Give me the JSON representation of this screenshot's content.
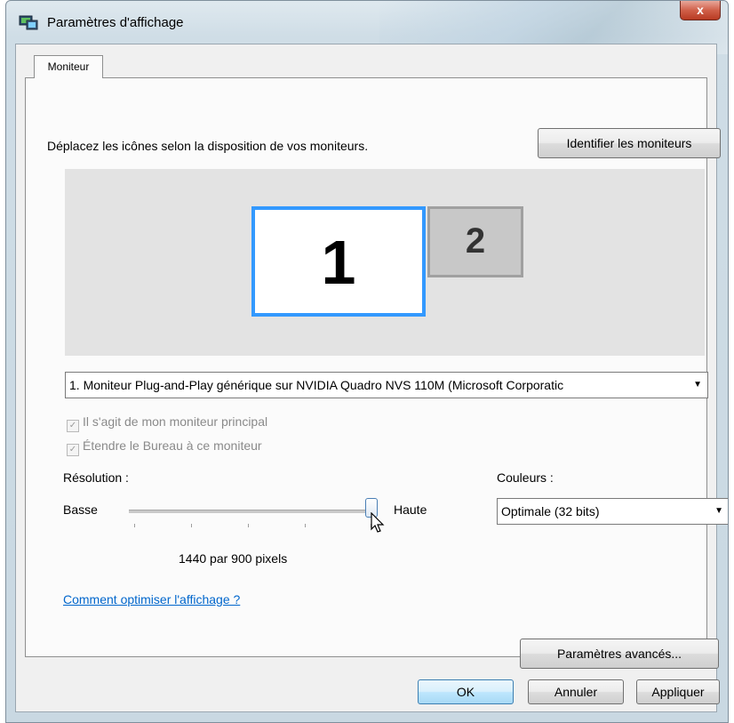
{
  "window": {
    "title": "Paramètres d'affichage",
    "close_label": "x"
  },
  "tabs": [
    {
      "label": "Moniteur",
      "selected": true
    }
  ],
  "main": {
    "instruction": "Déplacez les icônes selon la disposition de vos moniteurs.",
    "identify_button": "Identifier les moniteurs",
    "monitors": [
      {
        "number": "1",
        "selected": true
      },
      {
        "number": "2",
        "selected": false
      }
    ],
    "monitor_select": {
      "value": "1. Moniteur Plug-and-Play générique sur NVIDIA Quadro NVS 110M (Microsoft Corporatic",
      "arrow": "▼"
    },
    "checkboxes": [
      {
        "label": "Il s'agit de mon moniteur principal",
        "checked": true,
        "enabled": false
      },
      {
        "label": "Étendre le Bureau à ce moniteur",
        "checked": true,
        "enabled": false
      }
    ],
    "resolution": {
      "label": "Résolution :",
      "low_label": "Basse",
      "high_label": "Haute",
      "value_text": "1440 par 900 pixels",
      "slider_position": 1.0
    },
    "colors": {
      "label": "Couleurs :",
      "value": "Optimale (32 bits)",
      "arrow": "▼"
    },
    "help_link": "Comment optimiser l'affichage ?",
    "advanced_button": "Paramètres avancés..."
  },
  "footer": {
    "ok": "OK",
    "cancel": "Annuler",
    "apply": "Appliquer"
  },
  "colors": {
    "selection_border": "#3399ff",
    "link": "#0066cc",
    "close_button": "#c8462e"
  },
  "icons": {
    "app": "display-settings-icon",
    "checkbox_mark": "✓"
  }
}
